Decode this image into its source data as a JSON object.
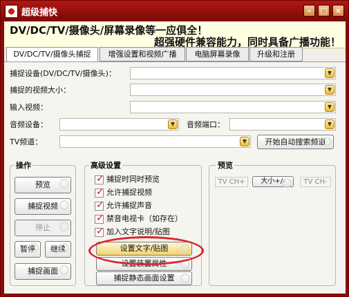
{
  "window": {
    "title": "超级捕快"
  },
  "banner": {
    "line1": "DV/DC/TV/摄像头/屏幕录像等一应俱全！",
    "line2": "超强硬件兼容能力，同时具备广播功能！"
  },
  "tabs": [
    "DV/DC/TV/摄像头捕捉",
    "增强设置和视频广播",
    "电脑屏幕录像",
    "升级和注册"
  ],
  "form": {
    "capture_device_label": "捕捉设备(DV/DC/TV/摄像头)：",
    "capture_size_label": "捕捉的视频大小：",
    "input_video_label": "输入视频：",
    "audio_device_label": "音频设备：",
    "audio_port_label": "音频端口：",
    "tv_channel_label": "TV频道：",
    "auto_search_button": "开始自动搜索频道"
  },
  "operation": {
    "title": "操作",
    "preview": "预览",
    "capture_video": "捕捉视频",
    "stop": "停止",
    "pause": "暂停",
    "resume": "继续",
    "capture_frame": "捕捉画面"
  },
  "advanced": {
    "title": "高级设置",
    "options": [
      "捕捉时同时预览",
      "允许捕捉视频",
      "允许捕捉声音",
      "禁音电视卡（如存在）",
      "加入文字说明/贴图"
    ],
    "buttons": [
      "设置文字/贴图",
      "设置装置属性",
      "捕捉静态画面设置"
    ]
  },
  "preview": {
    "title": "预览",
    "tv_ch_plus": "TV CH+",
    "size_toggle": "大小+/-",
    "tv_ch_minus": "TV CH-"
  }
}
